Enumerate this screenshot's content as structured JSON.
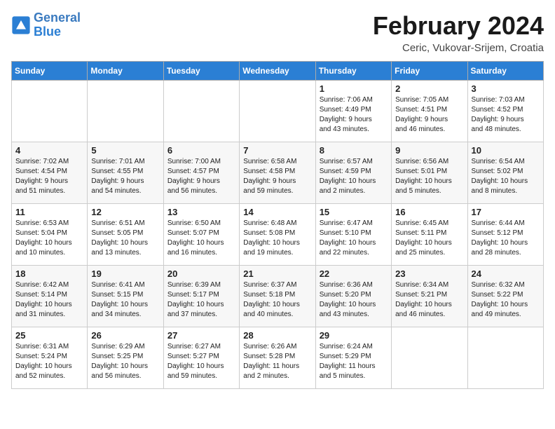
{
  "header": {
    "logo_line1": "General",
    "logo_line2": "Blue",
    "month": "February 2024",
    "location": "Ceric, Vukovar-Srijem, Croatia"
  },
  "weekdays": [
    "Sunday",
    "Monday",
    "Tuesday",
    "Wednesday",
    "Thursday",
    "Friday",
    "Saturday"
  ],
  "weeks": [
    [
      {
        "day": "",
        "info": ""
      },
      {
        "day": "",
        "info": ""
      },
      {
        "day": "",
        "info": ""
      },
      {
        "day": "",
        "info": ""
      },
      {
        "day": "1",
        "info": "Sunrise: 7:06 AM\nSunset: 4:49 PM\nDaylight: 9 hours\nand 43 minutes."
      },
      {
        "day": "2",
        "info": "Sunrise: 7:05 AM\nSunset: 4:51 PM\nDaylight: 9 hours\nand 46 minutes."
      },
      {
        "day": "3",
        "info": "Sunrise: 7:03 AM\nSunset: 4:52 PM\nDaylight: 9 hours\nand 48 minutes."
      }
    ],
    [
      {
        "day": "4",
        "info": "Sunrise: 7:02 AM\nSunset: 4:54 PM\nDaylight: 9 hours\nand 51 minutes."
      },
      {
        "day": "5",
        "info": "Sunrise: 7:01 AM\nSunset: 4:55 PM\nDaylight: 9 hours\nand 54 minutes."
      },
      {
        "day": "6",
        "info": "Sunrise: 7:00 AM\nSunset: 4:57 PM\nDaylight: 9 hours\nand 56 minutes."
      },
      {
        "day": "7",
        "info": "Sunrise: 6:58 AM\nSunset: 4:58 PM\nDaylight: 9 hours\nand 59 minutes."
      },
      {
        "day": "8",
        "info": "Sunrise: 6:57 AM\nSunset: 4:59 PM\nDaylight: 10 hours\nand 2 minutes."
      },
      {
        "day": "9",
        "info": "Sunrise: 6:56 AM\nSunset: 5:01 PM\nDaylight: 10 hours\nand 5 minutes."
      },
      {
        "day": "10",
        "info": "Sunrise: 6:54 AM\nSunset: 5:02 PM\nDaylight: 10 hours\nand 8 minutes."
      }
    ],
    [
      {
        "day": "11",
        "info": "Sunrise: 6:53 AM\nSunset: 5:04 PM\nDaylight: 10 hours\nand 10 minutes."
      },
      {
        "day": "12",
        "info": "Sunrise: 6:51 AM\nSunset: 5:05 PM\nDaylight: 10 hours\nand 13 minutes."
      },
      {
        "day": "13",
        "info": "Sunrise: 6:50 AM\nSunset: 5:07 PM\nDaylight: 10 hours\nand 16 minutes."
      },
      {
        "day": "14",
        "info": "Sunrise: 6:48 AM\nSunset: 5:08 PM\nDaylight: 10 hours\nand 19 minutes."
      },
      {
        "day": "15",
        "info": "Sunrise: 6:47 AM\nSunset: 5:10 PM\nDaylight: 10 hours\nand 22 minutes."
      },
      {
        "day": "16",
        "info": "Sunrise: 6:45 AM\nSunset: 5:11 PM\nDaylight: 10 hours\nand 25 minutes."
      },
      {
        "day": "17",
        "info": "Sunrise: 6:44 AM\nSunset: 5:12 PM\nDaylight: 10 hours\nand 28 minutes."
      }
    ],
    [
      {
        "day": "18",
        "info": "Sunrise: 6:42 AM\nSunset: 5:14 PM\nDaylight: 10 hours\nand 31 minutes."
      },
      {
        "day": "19",
        "info": "Sunrise: 6:41 AM\nSunset: 5:15 PM\nDaylight: 10 hours\nand 34 minutes."
      },
      {
        "day": "20",
        "info": "Sunrise: 6:39 AM\nSunset: 5:17 PM\nDaylight: 10 hours\nand 37 minutes."
      },
      {
        "day": "21",
        "info": "Sunrise: 6:37 AM\nSunset: 5:18 PM\nDaylight: 10 hours\nand 40 minutes."
      },
      {
        "day": "22",
        "info": "Sunrise: 6:36 AM\nSunset: 5:20 PM\nDaylight: 10 hours\nand 43 minutes."
      },
      {
        "day": "23",
        "info": "Sunrise: 6:34 AM\nSunset: 5:21 PM\nDaylight: 10 hours\nand 46 minutes."
      },
      {
        "day": "24",
        "info": "Sunrise: 6:32 AM\nSunset: 5:22 PM\nDaylight: 10 hours\nand 49 minutes."
      }
    ],
    [
      {
        "day": "25",
        "info": "Sunrise: 6:31 AM\nSunset: 5:24 PM\nDaylight: 10 hours\nand 52 minutes."
      },
      {
        "day": "26",
        "info": "Sunrise: 6:29 AM\nSunset: 5:25 PM\nDaylight: 10 hours\nand 56 minutes."
      },
      {
        "day": "27",
        "info": "Sunrise: 6:27 AM\nSunset: 5:27 PM\nDaylight: 10 hours\nand 59 minutes."
      },
      {
        "day": "28",
        "info": "Sunrise: 6:26 AM\nSunset: 5:28 PM\nDaylight: 11 hours\nand 2 minutes."
      },
      {
        "day": "29",
        "info": "Sunrise: 6:24 AM\nSunset: 5:29 PM\nDaylight: 11 hours\nand 5 minutes."
      },
      {
        "day": "",
        "info": ""
      },
      {
        "day": "",
        "info": ""
      }
    ]
  ]
}
